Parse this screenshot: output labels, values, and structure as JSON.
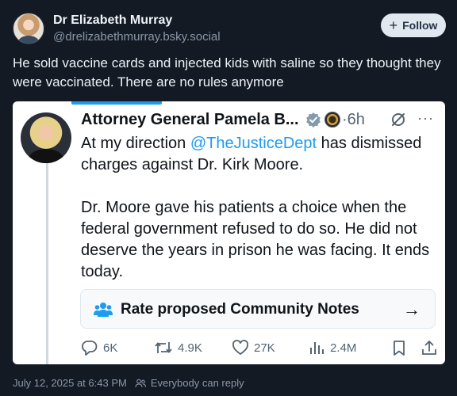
{
  "post": {
    "author_name": "Dr Elizabeth Murray",
    "author_handle": "@drelizabethmurray.bsky.social",
    "follow_label": "Follow",
    "text": "He sold vaccine cards and injected kids with saline so they thought they were vaccinated. There are no rules anymore"
  },
  "embed": {
    "name": "Attorney General Pamela B...",
    "time_sep": "·",
    "time": "6h",
    "text_before_mention": "At my direction ",
    "mention": "@TheJusticeDept",
    "text_after_mention": " has dismissed charges against Dr. Kirk Moore.",
    "paragraph2": "Dr. Moore gave his patients a choice when the federal government refused to do so. He did not deserve the years in prison he was facing. It ends today.",
    "community_notes_label": "Rate proposed Community Notes",
    "arrow": "→",
    "more": "···",
    "actions": {
      "replies": "6K",
      "reposts": "4.9K",
      "likes": "27K",
      "views": "2.4M"
    }
  },
  "footer": {
    "timestamp": "July 12, 2025 at 6:43 PM",
    "visibility": "Everybody can reply"
  },
  "colors": {
    "background": "#131a24",
    "mention": "#1d9bf0",
    "muted": "#8a97a8",
    "follow_bg": "#e2e8ef"
  },
  "icons": [
    "verified-icon",
    "seal-icon",
    "grok-icon",
    "more-icon",
    "people-icon",
    "reply-icon",
    "repost-icon",
    "like-icon",
    "views-icon",
    "bookmark-icon",
    "share-icon"
  ]
}
